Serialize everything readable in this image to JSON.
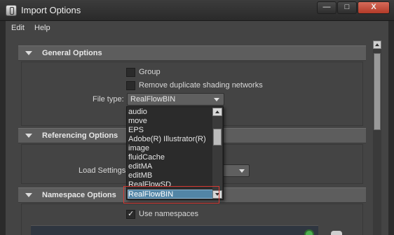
{
  "window": {
    "title": "Import Options",
    "buttons": {
      "minimize": "—",
      "maximize": "□",
      "close": "X"
    }
  },
  "menubar": {
    "items": [
      "Edit",
      "Help"
    ]
  },
  "sections": {
    "general": {
      "title": "General Options",
      "group_label": "Group",
      "remove_dup_label": "Remove duplicate shading networks",
      "file_type_label": "File type:",
      "file_type_value": "RealFlowBIN"
    },
    "referencing": {
      "title": "Referencing Options",
      "load_settings_label": "Load Settings"
    },
    "namespace": {
      "title": "Namespace Options",
      "use_namespaces_label": "Use namespaces",
      "use_namespaces_checked": true
    }
  },
  "file_type_options": [
    "audio",
    "move",
    "EPS",
    "Adobe(R) Illustrator(R)",
    "image",
    "fluidCache",
    "editMA",
    "editMB",
    "RealFlowSD",
    "RealFlowBIN"
  ],
  "selected_option": "RealFlowBIN",
  "icons": {
    "app": "maya-icon",
    "expand": "triangle-down-icon",
    "caret": "chevron-down-icon"
  },
  "colors": {
    "selection": "#5285a6",
    "highlight_border": "#d63a34",
    "status_dot": "#4caf50"
  }
}
